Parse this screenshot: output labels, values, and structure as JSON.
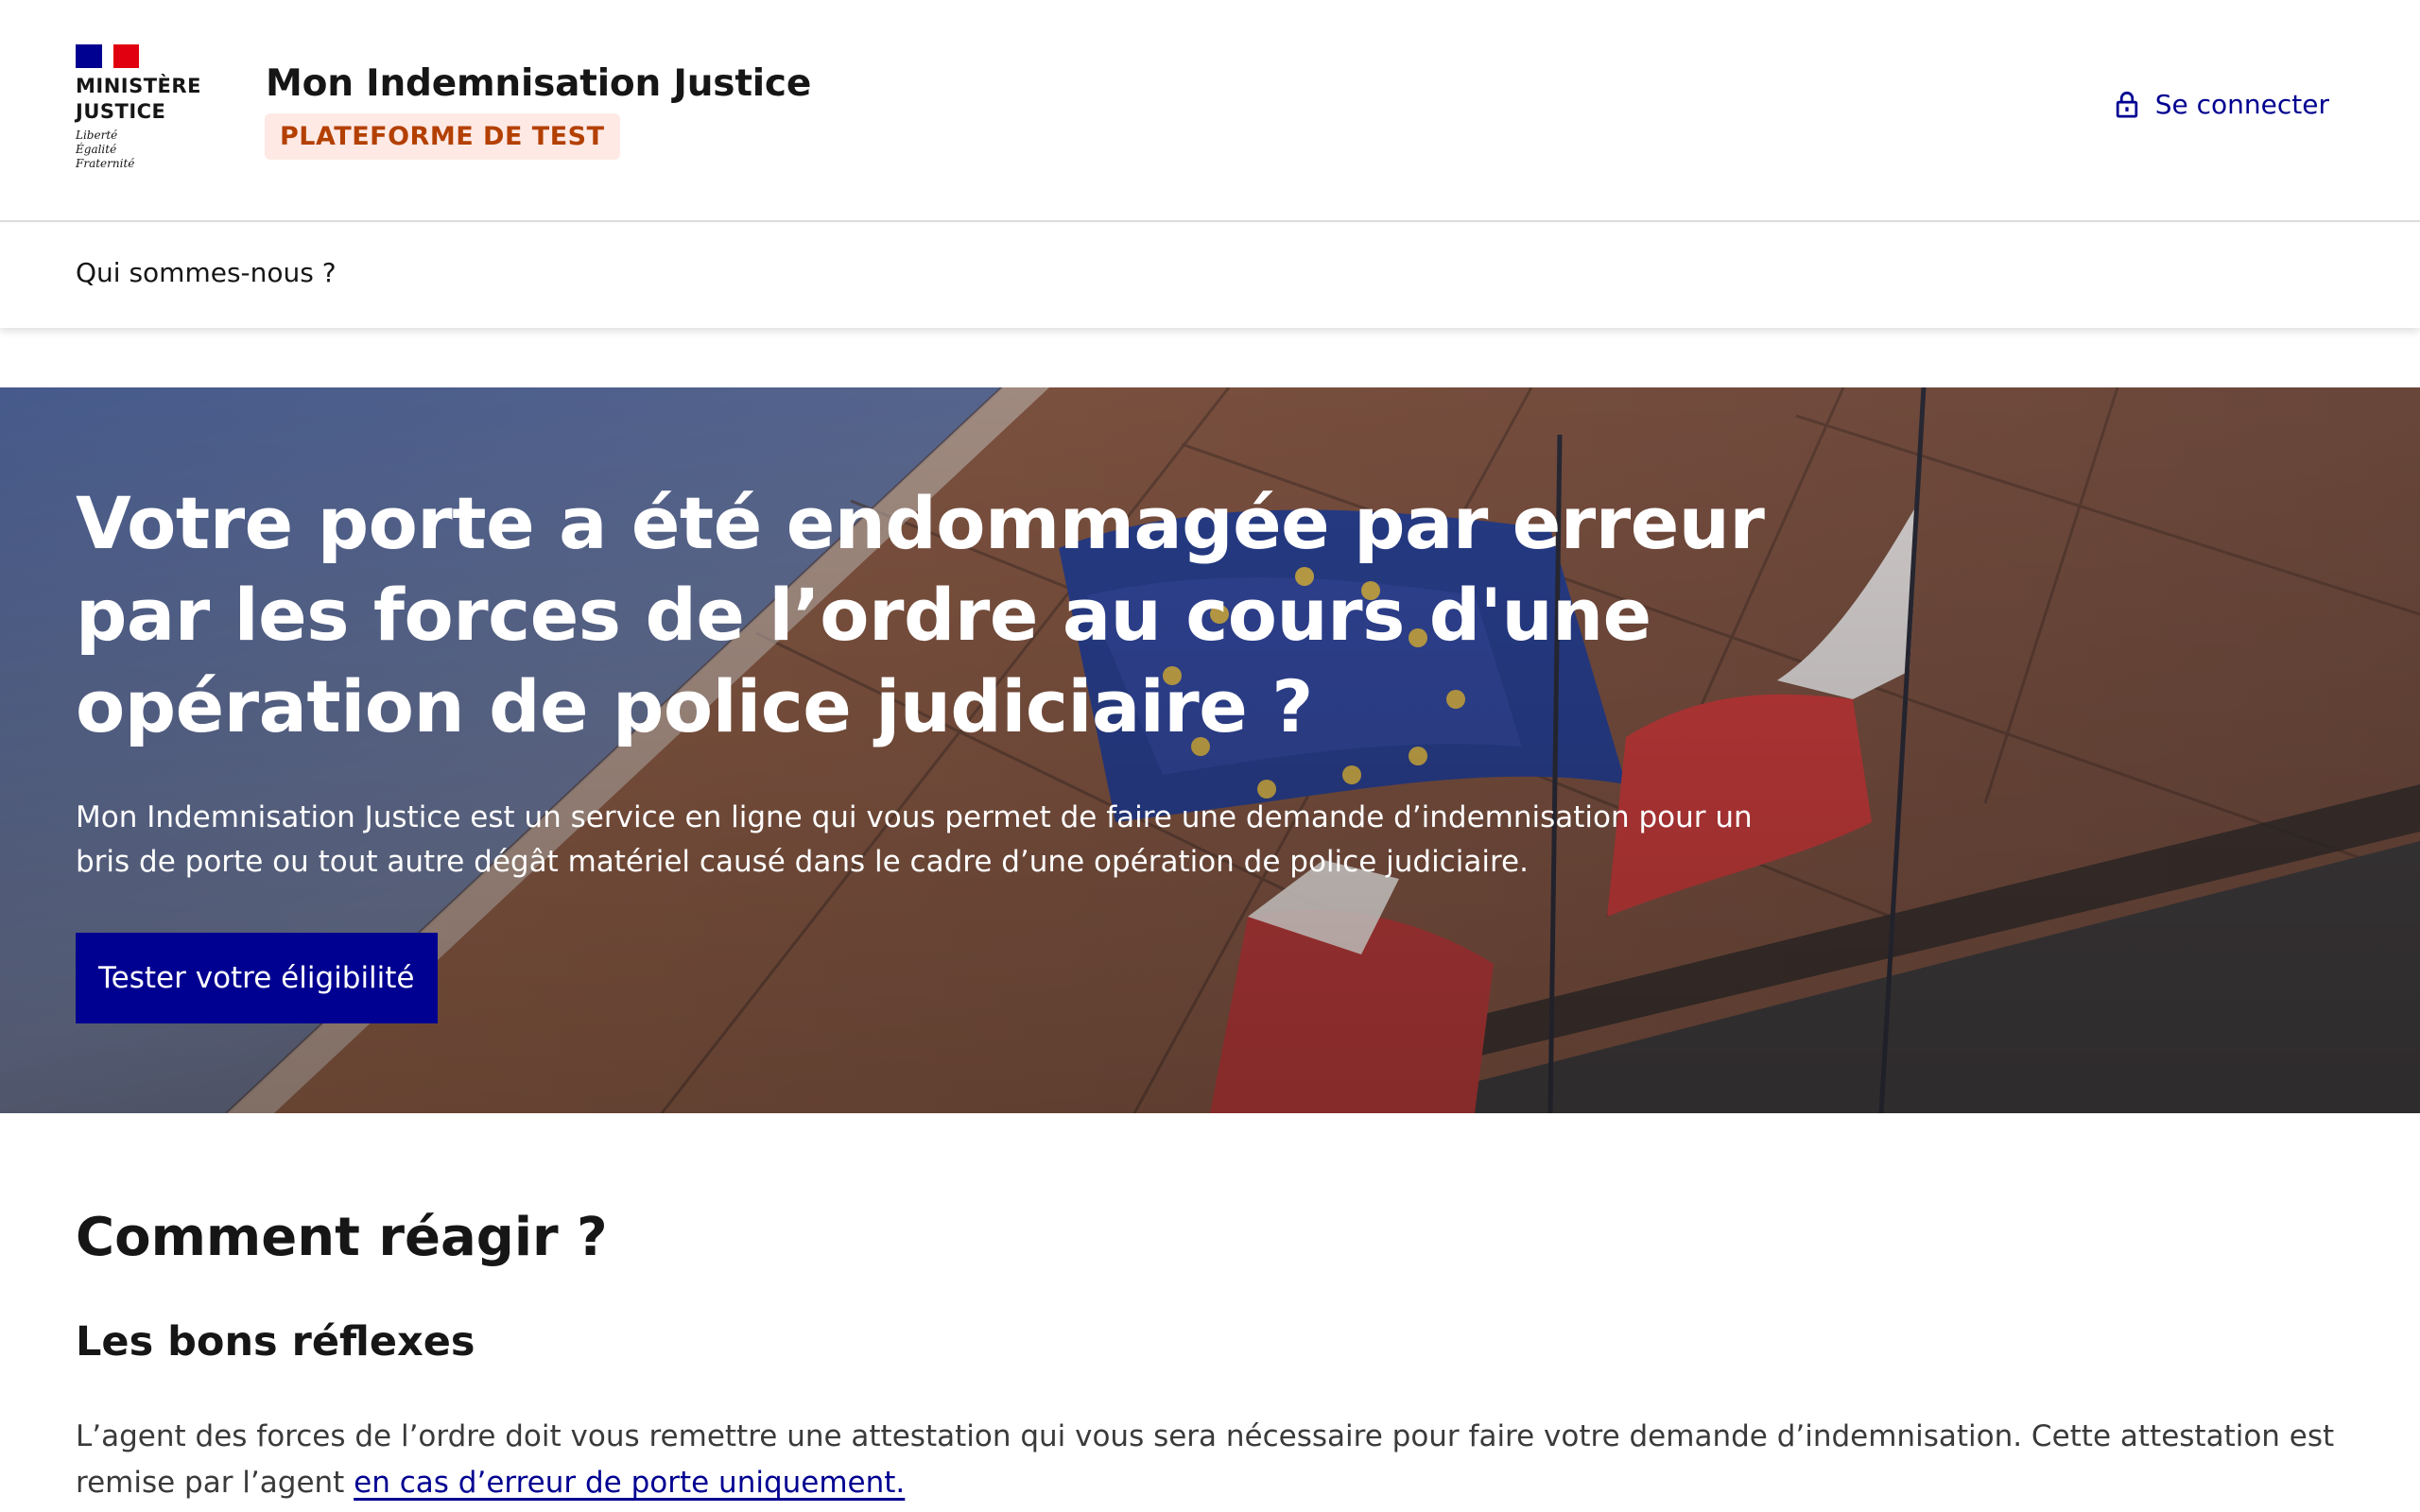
{
  "header": {
    "logo": {
      "line1": "MINISTÈRE",
      "line2": "JUSTICE",
      "motto": [
        "Liberté",
        "Égalité",
        "Fraternité"
      ]
    },
    "service_title": "Mon Indemnisation Justice",
    "badge": "PLATEFORME DE TEST",
    "login_label": "Se connecter"
  },
  "nav": {
    "items": [
      {
        "label": "Qui sommes-nous ?"
      }
    ]
  },
  "hero": {
    "title": "Votre porte a été endommagée par erreur par les forces de l’ordre au cours d'une opération de police judiciaire ?",
    "description": "Mon Indemnisation Justice est un service en ligne qui vous permet de faire une demande d’indemnisation pour un bris de porte ou tout autre dégât matériel causé dans le cadre d’une opération de police judiciaire.",
    "button_label": "Tester votre éligibilité"
  },
  "content": {
    "section_title": "Comment réagir ?",
    "subsection_title": "Les bons réflexes",
    "paragraph_text": "L’agent des forces de l’ordre doit vous remettre une attestation qui vous sera nécessaire pour faire votre demande d’indemnisation. Cette attestation est remise par l’agent ",
    "paragraph_link": "en cas d’erreur de porte uniquement."
  },
  "colors": {
    "primary": "#000091",
    "badge_bg": "#fee9e5",
    "badge_text": "#b34000",
    "flag_blue": "#000091",
    "flag_red": "#e1000f"
  },
  "icons": {
    "login": "lock-icon"
  }
}
